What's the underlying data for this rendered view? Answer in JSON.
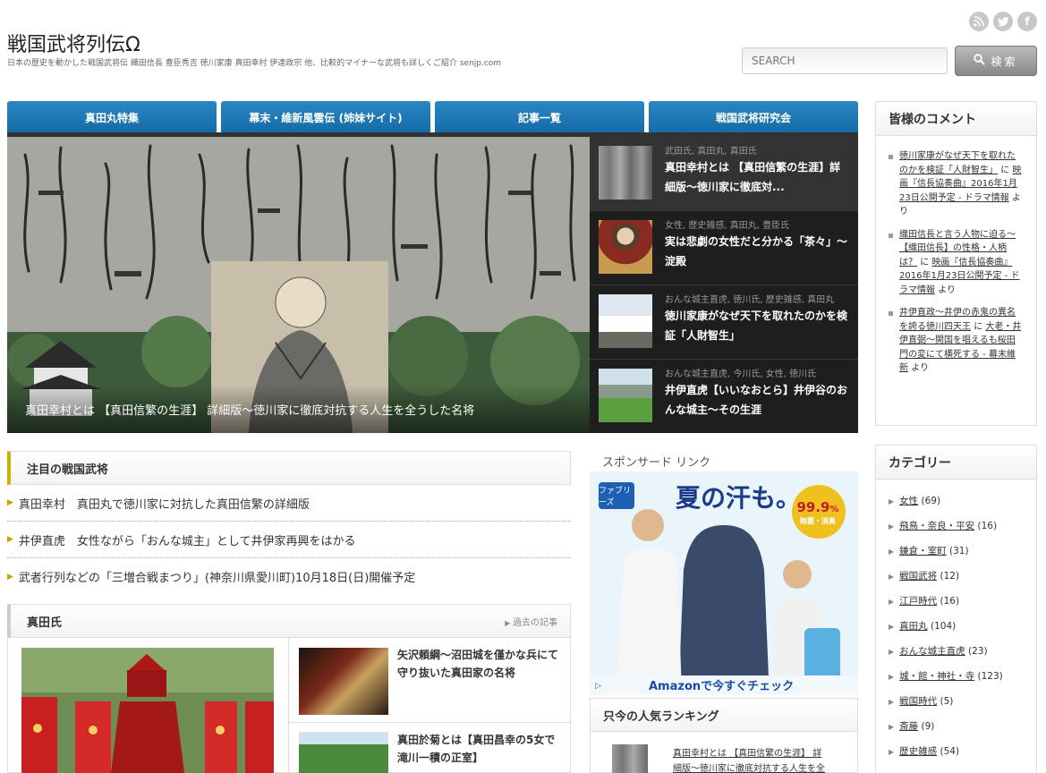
{
  "header": {
    "title": "戦国武将列伝Ω",
    "description": "日本の歴史を動かした戦国武将伝 織田信長 豊臣秀吉 徳川家康 真田幸村 伊達政宗 他、比較的マイナーな武将も詳しくご紹介 senjp.com",
    "social": [
      "rss-icon",
      "twitter-icon",
      "facebook-icon"
    ],
    "search_placeholder": "SEARCH",
    "search_label": "検索"
  },
  "nav": {
    "tabs": [
      "真田丸特集",
      "幕末・維新風雲伝 (姉妹サイト)",
      "記事一覧",
      "戦国武将研究会"
    ]
  },
  "slider": {
    "caption": "真田幸村とは 【真田信繁の生涯】 詳細版～徳川家に徹底対抗する人生を全うした名将",
    "items": [
      {
        "categories": "武田氏, 真田丸, 真田氏",
        "title": "真田幸村とは 【真田信繁の生涯】詳細版～徳川家に徹底対..."
      },
      {
        "categories": "女性, 歴史雑感, 真田丸, 豊臣氏",
        "title": "実は悲劇の女性だと分かる「茶々」～淀殿"
      },
      {
        "categories": "おんな城主直虎, 徳川氏, 歴史雑感, 真田丸",
        "title": "徳川家康がなぜ天下を取れたのかを検証「人財智生」"
      },
      {
        "categories": "おんな城主直虎, 今川氏, 女性, 徳川氏",
        "title": "井伊直虎【いいなおとら】井伊谷のおんな城主～その生涯"
      }
    ]
  },
  "featured": {
    "heading": "注目の戦国武将",
    "items": [
      "真田幸村　真田丸で徳川家に対抗した真田信繁の詳細版",
      "井伊直虎　女性ながら「おんな城主」として井伊家再興をはかる",
      "武者行列などの「三増合戦まつり」(神奈川県愛川町)10月18日(日)開催予定"
    ]
  },
  "sanada": {
    "heading": "真田氏",
    "past_link": "過去の記事",
    "articles": [
      "矢沢頼綱～沼田城を僅かな兵にて守り抜いた真田家の名将",
      "真田於菊とは【真田昌幸の5女で滝川一積の正室】"
    ]
  },
  "sponsor": {
    "label": "スポンサード リンク",
    "ad_headline": "夏の汗も。",
    "ad_brand": "ファブリーズ",
    "ad_badge_top": "99.9",
    "ad_badge_pct": "%",
    "ad_badge_bottom": "除菌・消臭",
    "ad_cta": "Amazonで今すぐチェック"
  },
  "ranking": {
    "heading": "只今の人気ランキング",
    "first_item_line1": "真田幸村とは 【真田信繁の生涯】 詳",
    "first_item_line2": "細版～徳川家に徹底対抗する人生を全"
  },
  "comments": {
    "heading": "皆様のコメント",
    "items": [
      {
        "link": "徳川家康がなぜ天下を取れたのかを検証「人財智生」",
        "mid": "に",
        "author": "映画『信長協奏曲』2016年1月23日公開予定 - ドラマ情報",
        "suffix": "より"
      },
      {
        "link": "織田信長と言う人物に迫る～【織田信長】の性格・人柄は？",
        "mid": "に",
        "author": "映画『信長協奏曲』2016年1月23日公開予定 - ドラマ情報",
        "suffix": "より"
      },
      {
        "link": "井伊直政～井伊の赤鬼の異名を誇る徳川四天王",
        "mid": "に",
        "author": "大老・井伊直弼～開国を唱えるも桜田門の変にて横死する - 幕末維新",
        "suffix": "より"
      }
    ]
  },
  "categories": {
    "heading": "カテゴリー",
    "items": [
      {
        "name": "女性",
        "count": "(69)"
      },
      {
        "name": "飛鳥・奈良・平安",
        "count": "(16)"
      },
      {
        "name": "鎌倉・室町",
        "count": "(31)"
      },
      {
        "name": "戦国武将",
        "count": "(12)"
      },
      {
        "name": "江戸時代",
        "count": "(16)"
      },
      {
        "name": "真田丸",
        "count": "(104)"
      },
      {
        "name": "おんな城主直虎",
        "count": "(23)"
      },
      {
        "name": "城・館・神社・寺",
        "count": "(123)"
      },
      {
        "name": "戦国時代",
        "count": "(5)"
      },
      {
        "name": "斎藤",
        "count": "(9)"
      },
      {
        "name": "歴史雑感",
        "count": "(54)"
      }
    ]
  },
  "colors": {
    "nav": "#1a73b0",
    "accent": "#c8b400",
    "slider_bg": "#1e1e1e"
  }
}
